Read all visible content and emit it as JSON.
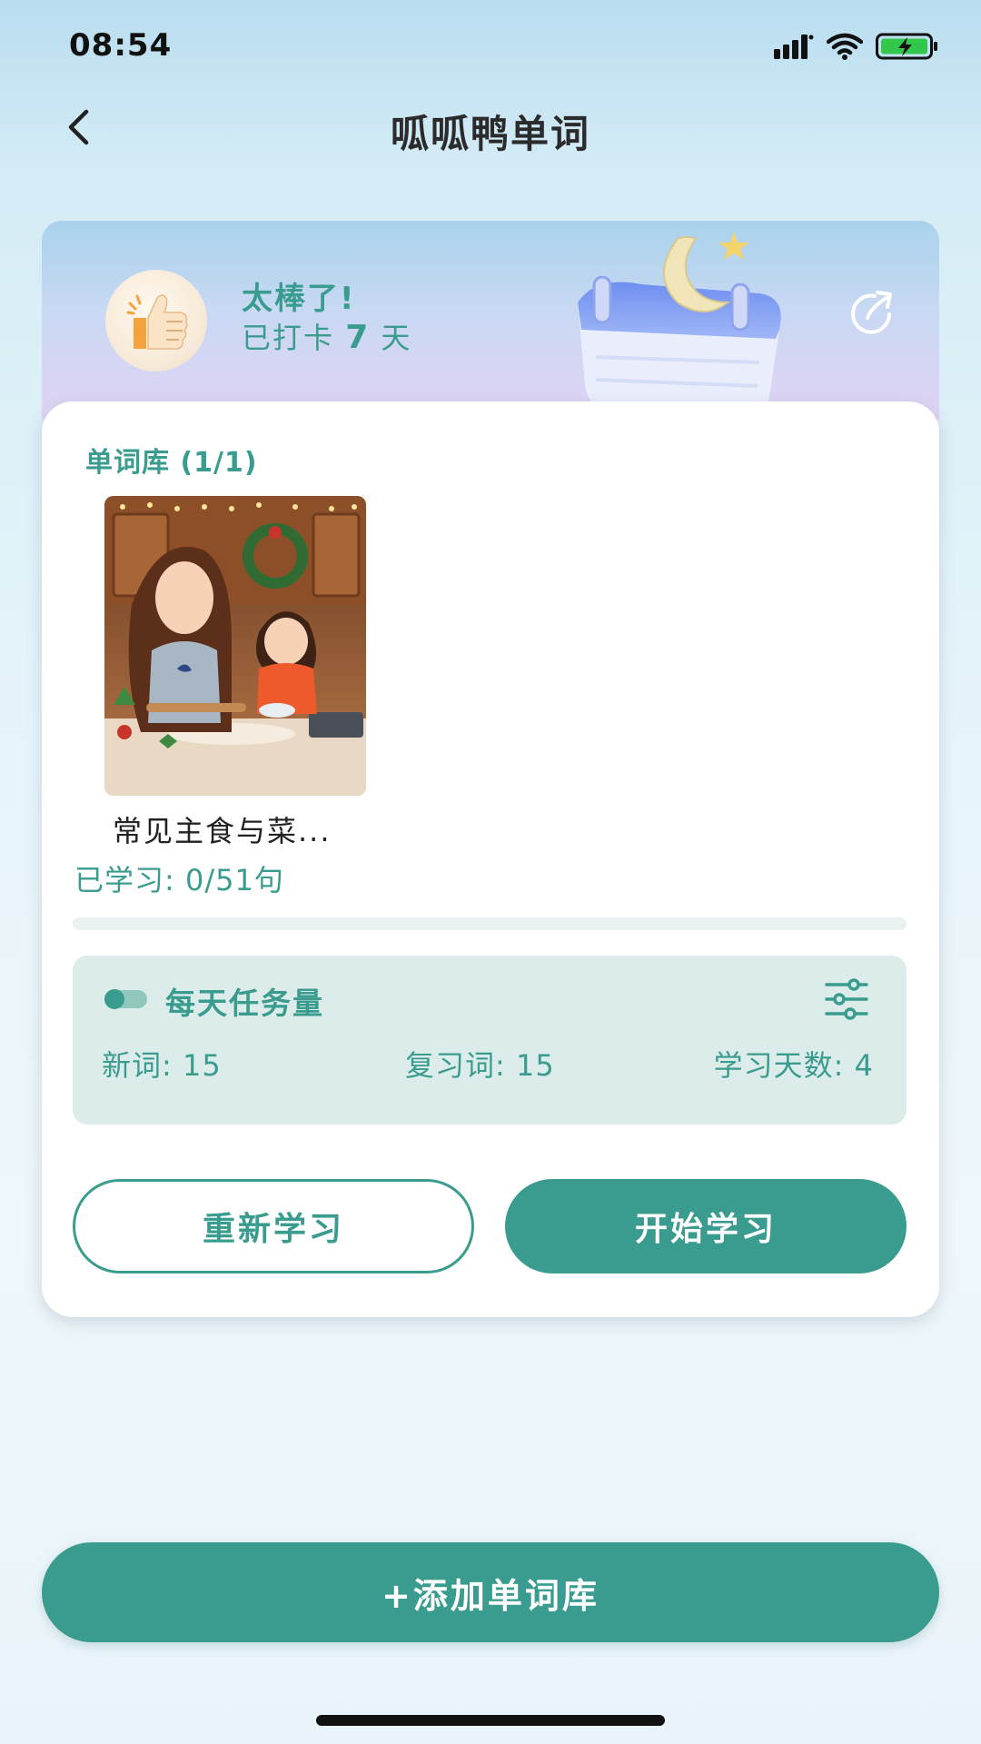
{
  "status_bar": {
    "time": "08:54"
  },
  "nav": {
    "title": "呱呱鸭单词"
  },
  "banner": {
    "title": "太棒了!",
    "checkin_prefix": "已打卡 ",
    "checkin_days": "7",
    "checkin_suffix": " 天"
  },
  "library": {
    "title": "单词库 (1/1)",
    "book_name": "常见主食与菜...",
    "learned": "已学习: 0/51句",
    "progress": 0
  },
  "daily_task": {
    "title": "每天任务量",
    "new_words": "新词: 15",
    "review_words": "复习词: 15",
    "study_days": "学习天数: 4"
  },
  "actions": {
    "restart": "重新学习",
    "start": "开始学习",
    "add_library": "+添加单词库"
  },
  "colors": {
    "accent": "#3a9c8e",
    "task_bg": "#dcecea"
  }
}
